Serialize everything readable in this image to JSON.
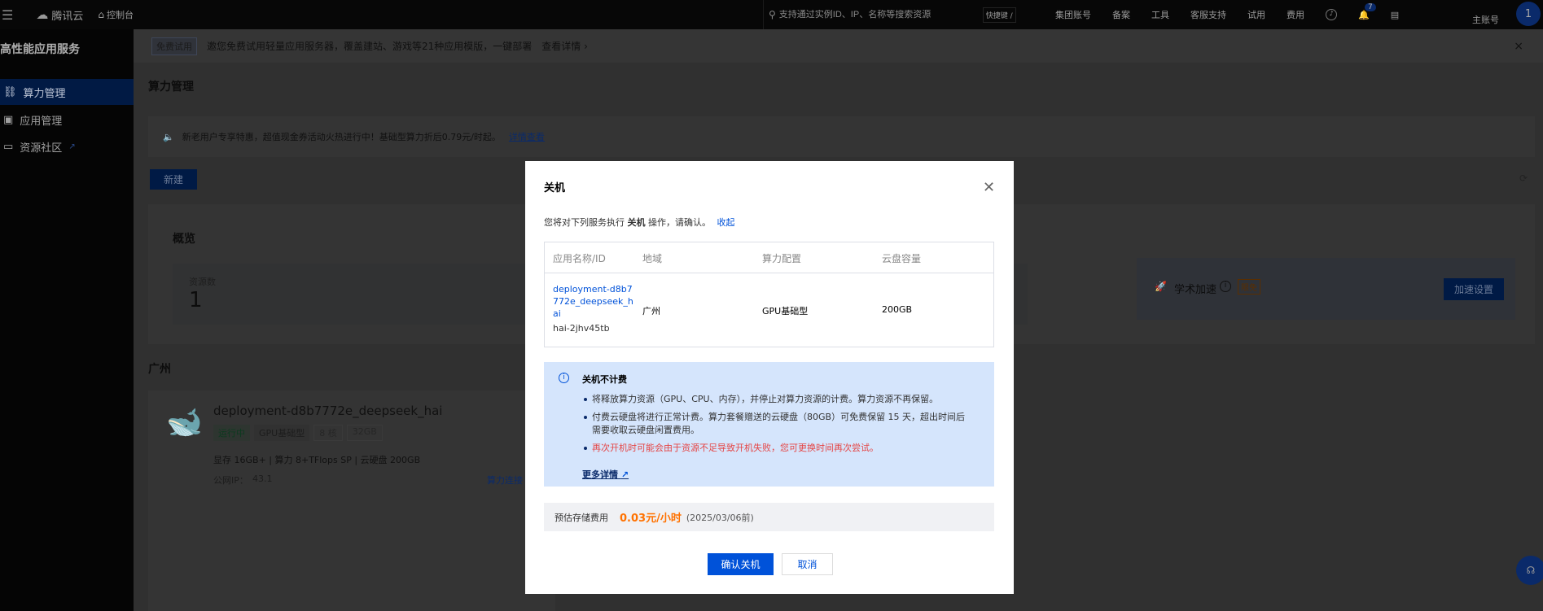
{
  "topbar": {
    "brand": "腾讯云",
    "console": "控制台",
    "search_placeholder": "支持通过实例ID、IP、名称等搜索资源",
    "shortcut": "快捷键 /",
    "nav": [
      "集团账号",
      "备案",
      "工具",
      "客服支持",
      "试用",
      "费用"
    ],
    "bell_count": "7",
    "account_label": "主账号",
    "avatar": "1"
  },
  "sidebar": {
    "title": "高性能应用服务",
    "items": [
      {
        "label": "算力管理"
      },
      {
        "label": "应用管理"
      },
      {
        "label": "资源社区"
      }
    ]
  },
  "banner": {
    "tag": "免费试用",
    "text": "邀您免费试用轻量应用服务器，覆盖建站、游戏等21种应用模版，一键部署",
    "link": "查看详情 ›",
    "close": "×"
  },
  "page": {
    "title": "算力管理",
    "notice": "新老用户专享特惠，超值现金券活动火热进行中！基础型算力折后0.79元/时起。",
    "notice_link": "详情查看",
    "new_button": "新建",
    "overview": {
      "title": "概览",
      "stat_label": "资源数",
      "stat_value": "1",
      "accel_label": "学术加速",
      "accel_badge": "限免",
      "accel_button": "加速设置"
    },
    "region": "广州",
    "instance": {
      "name": "deployment-d8b7772e_deepseek_hai",
      "status": "运行中",
      "type": "GPU基础型",
      "cores": "8 核",
      "memory": "32GB",
      "specs": "显存 16GB+ | 算力 8+TFlops SP | 云硬盘 200GB",
      "ip_label": "公网IP：",
      "ip": "43.1",
      "connect": "算力连接"
    }
  },
  "modal": {
    "title": "关机",
    "desc_prefix": "您将对下列服务执行",
    "desc_action": "关机",
    "desc_suffix": "操作，请确认。",
    "collapse": "收起",
    "table": {
      "headers": [
        "应用名称/ID",
        "地域",
        "算力配置",
        "云盘容量"
      ],
      "row": {
        "name": "deployment-d8b7772e_deepseek_hai",
        "id": "hai-2jhv45tb",
        "region": "广州",
        "config": "GPU基础型",
        "disk": "200GB"
      }
    },
    "info": {
      "title": "关机不计费",
      "items": [
        "将释放算力资源（GPU、CPU、内存），并停止对算力资源的计费。算力资源不再保留。",
        "付费云硬盘将进行正常计费。算力套餐赠送的云硬盘（80GB）可免费保留 15 天，超出时间后需要收取云硬盘闲置费用。"
      ],
      "warning": "再次开机时可能会由于资源不足导致开机失败，您可更换时间再次尝试。",
      "more": "更多详情"
    },
    "cost": {
      "label": "预估存储费用",
      "price": "0.03元/小时",
      "note": "(2025/03/06前)"
    },
    "confirm": "确认关机",
    "cancel": "取消"
  },
  "colors": {
    "primary": "#0052d9",
    "warning": "#e54545",
    "price": "#ff7200"
  }
}
